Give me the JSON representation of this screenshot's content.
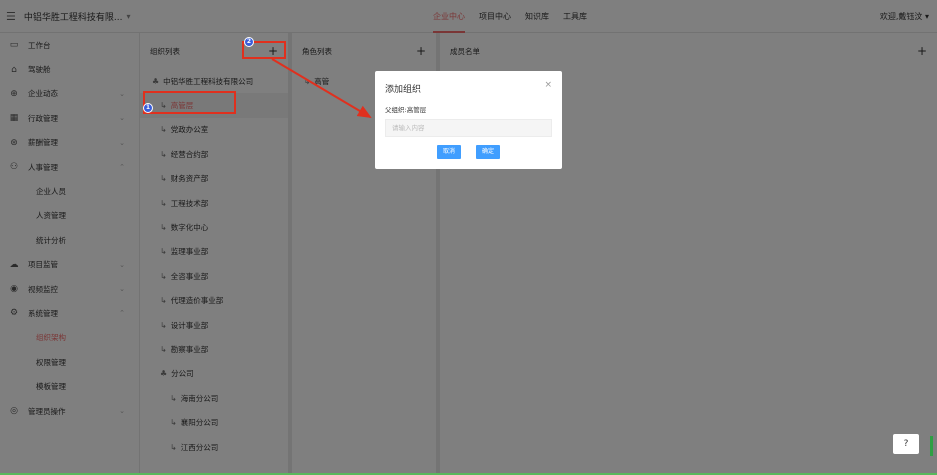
{
  "header": {
    "company": "中铝华胜工程科技有限...",
    "nav": [
      "企业中心",
      "项目中心",
      "知识库",
      "工具库"
    ],
    "active_nav": "企业中心",
    "welcome": "欢迎,戴钰汶"
  },
  "sidebar": {
    "items": [
      {
        "label": "工作台",
        "icon": "monitor-icon",
        "chevron": false
      },
      {
        "label": "驾驶舱",
        "icon": "home-icon",
        "chevron": false
      },
      {
        "label": "企业动态",
        "icon": "globe-icon",
        "chevron": true
      },
      {
        "label": "行政管理",
        "icon": "grid-icon",
        "chevron": true
      },
      {
        "label": "薪酬管理",
        "icon": "money-icon",
        "chevron": true
      },
      {
        "label": "人事管理",
        "icon": "users-icon",
        "chevron": true
      },
      {
        "label": "企业人员",
        "sub": true
      },
      {
        "label": "人资管理",
        "sub": true
      },
      {
        "label": "统计分析",
        "sub": true
      },
      {
        "label": "项目监管",
        "icon": "cloud-icon",
        "chevron": true
      },
      {
        "label": "视频监控",
        "icon": "location-icon",
        "chevron": true
      },
      {
        "label": "系统管理",
        "icon": "settings-icon",
        "chevron": true
      },
      {
        "label": "组织架构",
        "sub": true,
        "active": true
      },
      {
        "label": "权限管理",
        "sub": true
      },
      {
        "label": "模板管理",
        "sub": true
      },
      {
        "label": "管理员操作",
        "icon": "admin-icon",
        "chevron": true
      }
    ]
  },
  "org_panel": {
    "title": "组织列表",
    "plus": "+",
    "items": [
      {
        "label": "中铝华胜工程科技有限公司",
        "level": 0,
        "icon": "org-icon"
      },
      {
        "label": "高管层",
        "level": 1,
        "icon": "node-icon",
        "selected": true
      },
      {
        "label": "党政办公室",
        "level": 1,
        "icon": "node-icon"
      },
      {
        "label": "经营合约部",
        "level": 1,
        "icon": "node-icon"
      },
      {
        "label": "财务资产部",
        "level": 1,
        "icon": "node-icon"
      },
      {
        "label": "工程技术部",
        "level": 1,
        "icon": "node-icon"
      },
      {
        "label": "数字化中心",
        "level": 1,
        "icon": "node-icon"
      },
      {
        "label": "监理事业部",
        "level": 1,
        "icon": "node-icon"
      },
      {
        "label": "全咨事业部",
        "level": 1,
        "icon": "node-icon"
      },
      {
        "label": "代理造价事业部",
        "level": 1,
        "icon": "node-icon"
      },
      {
        "label": "设计事业部",
        "level": 1,
        "icon": "node-icon"
      },
      {
        "label": "勘察事业部",
        "level": 1,
        "icon": "node-icon"
      },
      {
        "label": "分公司",
        "level": 1,
        "icon": "org-icon"
      },
      {
        "label": "海南分公司",
        "level": 2,
        "icon": "node-icon"
      },
      {
        "label": "襄阳分公司",
        "level": 2,
        "icon": "node-icon"
      },
      {
        "label": "江西分公司",
        "level": 2,
        "icon": "node-icon"
      }
    ]
  },
  "role_panel": {
    "title": "角色列表",
    "plus": "+",
    "items": [
      "高管"
    ]
  },
  "member_panel": {
    "title": "成员名单",
    "plus": "+"
  },
  "dialog": {
    "title": "添加组织",
    "close": "×",
    "parent_label": "父组织:高管层",
    "input_placeholder": "请输入内容",
    "input_value": "",
    "cancel": "取消",
    "confirm": "确定"
  },
  "annotations": {
    "badge1": "1",
    "badge2": "2",
    "highlight_color": "#e0301e",
    "badge_color": "#3a5edb"
  },
  "help": "?"
}
